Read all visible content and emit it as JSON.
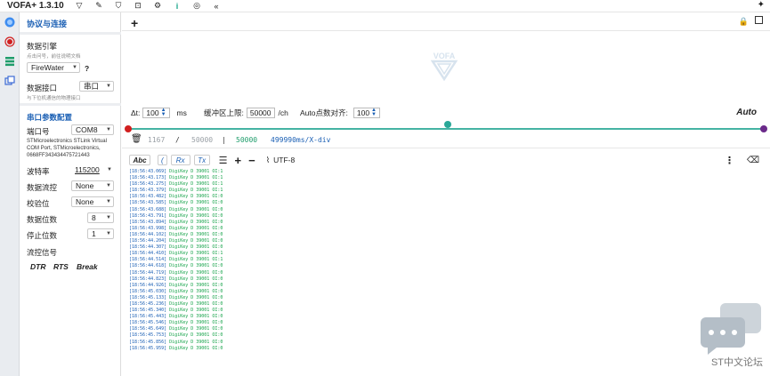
{
  "title_bar": {
    "app_title": "VOFA+ 1.3.10",
    "icons": [
      "vofa-logo-icon",
      "wrench-icon",
      "shirt-icon",
      "screenshot-icon",
      "plugin-icon",
      "info-icon",
      "fingerprint-icon",
      "collapse-icon"
    ]
  },
  "sidebar": {
    "section_title": "协议与连接",
    "engine_label": "数据引擎",
    "engine_hint": "点击问号，前往说明文档",
    "engine_value": "FireWater",
    "engine_help": "?",
    "interface_label": "数据接口",
    "interface_value": "串口",
    "interface_hint": "与下位机通信的物理接口",
    "serial_section_title": "串口参数配置",
    "port_label": "端口号",
    "port_value": "COM8",
    "port_desc": "STMicroelectronics STLink Virtual COM Port, STMicroelectronics, 0668FF343434475721443",
    "baud_label": "波特率",
    "baud_value": "115200",
    "flow_label": "数据流控",
    "flow_value": "None",
    "parity_label": "校验位",
    "parity_value": "None",
    "databits_label": "数据位数",
    "databits_value": "8",
    "stopbits_label": "停止位数",
    "stopbits_value": "1",
    "signal_label": "流控信号",
    "dtr": "DTR",
    "rts": "RTS",
    "brk": "Break"
  },
  "main": {
    "add_tab": "+",
    "delta_t_label": "Δt:",
    "delta_t_value": "100",
    "delta_t_unit": "ms",
    "buffer_label": "缓冲区上限:",
    "buffer_value": "50000",
    "buffer_unit": "/ch",
    "auto_align_label": "Auto点数对齐:",
    "auto_align_value": "100",
    "auto_label": "Auto",
    "stat_count": "1167",
    "stat_sep1": "/",
    "stat_total": "50000",
    "stat_sep2": "|",
    "stat_buffer": "50000",
    "stat_xdiv": "499990ms/X-div",
    "toolbar_abc": "Abc",
    "toolbar_rx": "Rx",
    "toolbar_tx": "Tx",
    "toolbar_encoding": "UTF-8",
    "log_lines": [
      [
        "[18:56:43.069]",
        "DigiKey D 39001 OI:1"
      ],
      [
        "[18:56:43.173]",
        "DigiKey D 39001 OI:1"
      ],
      [
        "[18:56:43.275]",
        "DigiKey D 39001 OI:1"
      ],
      [
        "[18:56:43.379]",
        "DigiKey D 39001 OI:1"
      ],
      [
        "[18:56:43.482]",
        "DigiKey D 39001 OI:0"
      ],
      [
        "[18:56:43.585]",
        "DigiKey D 39001 OI:0"
      ],
      [
        "[18:56:43.688]",
        "DigiKey D 39001 OI:0"
      ],
      [
        "[18:56:43.791]",
        "DigiKey D 39001 OI:0"
      ],
      [
        "[18:56:43.894]",
        "DigiKey D 39001 OI:0"
      ],
      [
        "[18:56:43.998]",
        "DigiKey D 39001 OI:0"
      ],
      [
        "[18:56:44.102]",
        "DigiKey D 39001 OI:0"
      ],
      [
        "[18:56:44.204]",
        "DigiKey D 39001 OI:0"
      ],
      [
        "[18:56:44.307]",
        "DigiKey D 39001 OI:0"
      ],
      [
        "[18:56:44.410]",
        "DigiKey D 39001 OI:1"
      ],
      [
        "[18:56:44.514]",
        "DigiKey D 39001 OI:1"
      ],
      [
        "[18:56:44.618]",
        "DigiKey D 39001 OI:0"
      ],
      [
        "[18:56:44.719]",
        "DigiKey D 39001 OI:0"
      ],
      [
        "[18:56:44.823]",
        "DigiKey D 39001 OI:0"
      ],
      [
        "[18:56:44.926]",
        "DigiKey D 39001 OI:0"
      ],
      [
        "[18:56:45.030]",
        "DigiKey D 39001 OI:0"
      ],
      [
        "[18:56:45.133]",
        "DigiKey D 39001 OI:0"
      ],
      [
        "[18:56:45.236]",
        "DigiKey D 39001 OI:0"
      ],
      [
        "[18:56:45.340]",
        "DigiKey D 39001 OI:0"
      ],
      [
        "[18:56:45.443]",
        "DigiKey D 39001 OI:0"
      ],
      [
        "[18:56:45.546]",
        "DigiKey D 39001 OI:0"
      ],
      [
        "[18:56:45.649]",
        "DigiKey D 39001 OI:0"
      ],
      [
        "[18:56:45.753]",
        "DigiKey D 39001 OI:0"
      ],
      [
        "[18:56:45.856]",
        "DigiKey D 39001 OI:0"
      ],
      [
        "[18:56:45.959]",
        "DigiKey D 39001 OI:0"
      ]
    ]
  },
  "watermark": "ST中文论坛",
  "colors": {
    "accent": "#1a5fb4",
    "slider": "#45b3a3",
    "red_knob": "#d11f1f",
    "purple_knob": "#6b2a8a",
    "log_text": "#16a34a"
  }
}
